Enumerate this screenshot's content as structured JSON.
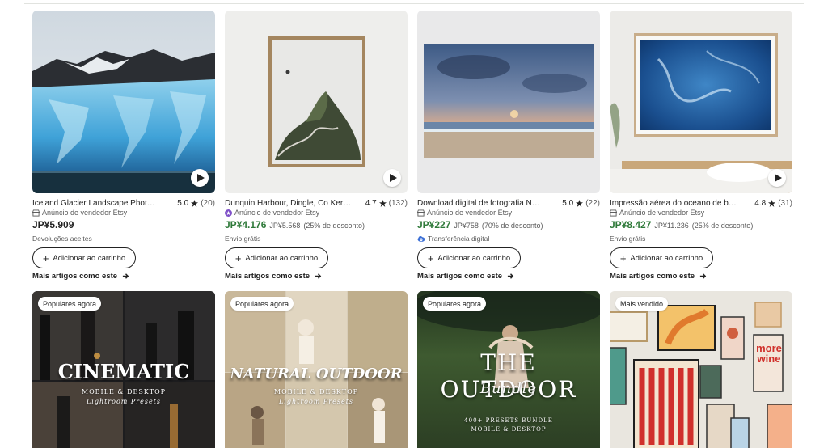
{
  "products": [
    {
      "title": "Iceland Glacier Landscape Phot…",
      "rating": "5.0",
      "reviews": "(20)",
      "seller": "Anúncio de vendedor Etsy",
      "price": "JP¥5.909",
      "extra": "Devoluções aceites",
      "cart_label": "Adicionar ao carrinho",
      "more_label": "Mais artigos como este"
    },
    {
      "title": "Dunquin Harbour, Dingle, Co Ker…",
      "rating": "4.7",
      "reviews": "(132)",
      "seller": "Anúncio de vendedor Etsy",
      "price": "JP¥4.176",
      "original_price": "JP¥5.568",
      "discount": "(25% de desconto)",
      "extra": "Envio grátis",
      "cart_label": "Adicionar ao carrinho",
      "more_label": "Mais artigos como este"
    },
    {
      "title": "Download digital de fotografia N…",
      "rating": "5.0",
      "reviews": "(22)",
      "seller": "Anúncio de vendedor Etsy",
      "price": "JP¥227",
      "original_price": "JP¥758",
      "discount": "(70% de desconto)",
      "extra": "Transferência digital",
      "cart_label": "Adicionar ao carrinho",
      "more_label": "Mais artigos como este"
    },
    {
      "title": "Impressão aérea do oceano de b…",
      "rating": "4.8",
      "reviews": "(31)",
      "seller": "Anúncio de vendedor Etsy",
      "price": "JP¥8.427",
      "original_price": "JP¥11.236",
      "discount": "(25% de desconto)",
      "extra": "Envio grátis",
      "cart_label": "Adicionar ao carrinho",
      "more_label": "Mais artigos como este"
    }
  ],
  "row2": [
    {
      "badge": "Populares agora",
      "overlay_title": "CINEMATIC",
      "overlay_sub1": "MOBILE & DESKTOP",
      "overlay_sub2": "Lightroom Presets"
    },
    {
      "badge": "Populares agora",
      "overlay_title": "NATURAL OUTDOOR",
      "overlay_sub1": "MOBILE & DESKTOP",
      "overlay_sub2": "Lightroom Presets"
    },
    {
      "badge": "Populares agora",
      "overlay_title": "THE OUTDOOR",
      "overlay_sub1": "Bundle",
      "overlay_sub2": "400+ PRESETS BUNDLE",
      "overlay_sub3": "MOBILE & DESKTOP"
    },
    {
      "badge": "Mais vendido",
      "poster_text_1": "more",
      "poster_text_2": "wine"
    }
  ],
  "colors": {
    "sale_price": "#2f7a3a",
    "text": "#222222",
    "muted": "#595959",
    "star_seller": "#7f50c8",
    "digital": "#3b6fd6"
  },
  "icons": [
    "play-icon",
    "star-icon",
    "shop-icon",
    "star-seller-icon",
    "cloud-download-icon",
    "plus-icon",
    "arrow-right-icon"
  ]
}
